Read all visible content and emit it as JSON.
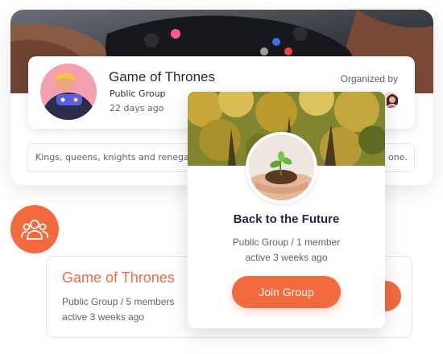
{
  "colors": {
    "accent": "#f26a3d",
    "text": "#1f2a36",
    "muted": "#5a6370",
    "border": "#e2e5ea"
  },
  "back_card": {
    "group_name": "Game of Thrones",
    "group_type": "Public Group",
    "created": "22 days ago",
    "organized_label": "Organized by",
    "description": "Kings, queens, knights and renegade",
    "description_tail": "one."
  },
  "badge": {
    "icon": "group-icon"
  },
  "bottom_card": {
    "group_name": "Game of Thrones",
    "meta": "Public Group / 5 members",
    "activity": "active 3 weeks ago"
  },
  "popup": {
    "group_name": "Back to the Future",
    "meta": "Public Group / 1 member",
    "activity": "active 3 weeks ago",
    "join_label": "Join Group"
  }
}
